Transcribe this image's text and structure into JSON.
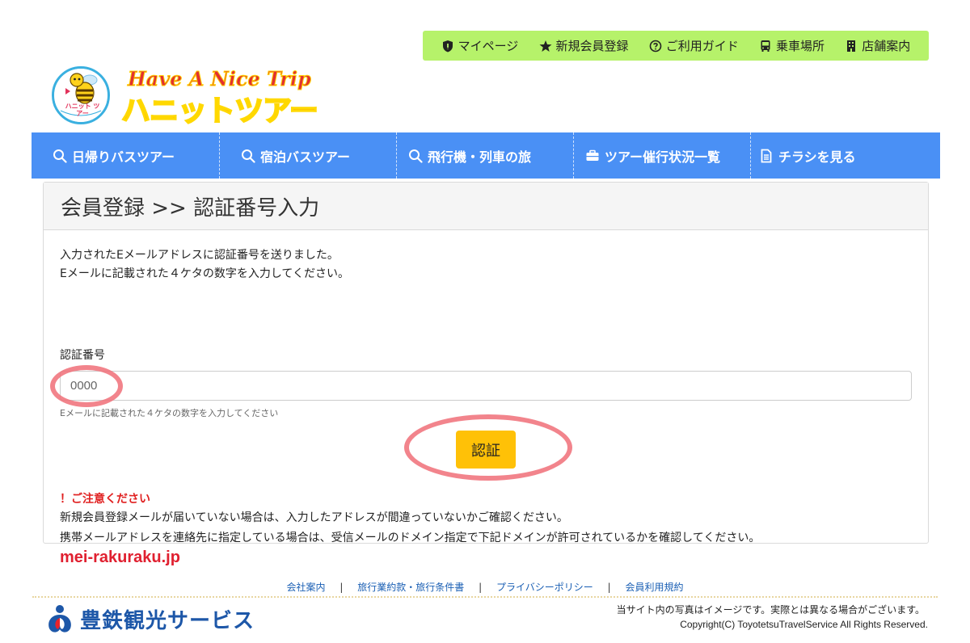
{
  "util_nav": {
    "items": [
      {
        "label": "マイページ",
        "icon": "shield-icon"
      },
      {
        "label": "新規会員登録",
        "icon": "star-icon"
      },
      {
        "label": "ご利用ガイド",
        "icon": "question-circle-icon"
      },
      {
        "label": "乗車場所",
        "icon": "bus-icon"
      },
      {
        "label": "店舗案内",
        "icon": "building-icon"
      }
    ]
  },
  "logo": {
    "line1": "Have A Nice Trip",
    "line2": "ハニットツアー",
    "badge_text": "ハニット ツアー"
  },
  "main_nav": {
    "items": [
      {
        "label": "日帰りバスツアー",
        "icon": "search-icon"
      },
      {
        "label": "宿泊バスツアー",
        "icon": "search-icon"
      },
      {
        "label": "飛行機・列車の旅",
        "icon": "search-icon"
      },
      {
        "label": "ツアー催行状況一覧",
        "icon": "briefcase-icon"
      },
      {
        "label": "チラシを見る",
        "icon": "document-icon"
      }
    ]
  },
  "panel": {
    "title": "会員登録 >> 認証番号入力",
    "intro_line1": "入力されたEメールアドレスに認証番号を送りました。",
    "intro_line2": "Eメールに記載された４ケタの数字を入力してください。",
    "field_label": "認証番号",
    "input_placeholder": "0000",
    "input_value": "",
    "help_text": "Eメールに記載された４ケタの数字を入力してください",
    "submit_label": "認証",
    "caution_title": "！ご注意ください",
    "caution_line1": "新規会員登録メールが届いていない場合は、入力したアドレスが間違っていないかご確認ください。",
    "caution_line2": "携帯メールアドレスを連絡先に指定している場合は、受信メールのドメイン指定で下記ドメインが許可されているかを確認してください。",
    "domain": "mei-rakuraku.jp"
  },
  "footer": {
    "links": [
      "会社案内",
      "旅行業約款・旅行条件書",
      "プライバシーポリシー",
      "会員利用規約"
    ],
    "separator": "|",
    "company_name": "豊鉄観光サービス",
    "disclaimer": "当サイト内の写真はイメージです。実際とは異なる場合がございます。",
    "copyright": "Copyright(C) ToyotetsuTravelService All Rights Reserved."
  },
  "colors": {
    "util_nav_bg": "#b6f26a",
    "main_nav_bg": "#4a90f5",
    "submit_bg": "#ffc107",
    "caution_red": "#e02020",
    "highlight_ring": "#f06e78",
    "company_blue": "#1d57a8"
  }
}
